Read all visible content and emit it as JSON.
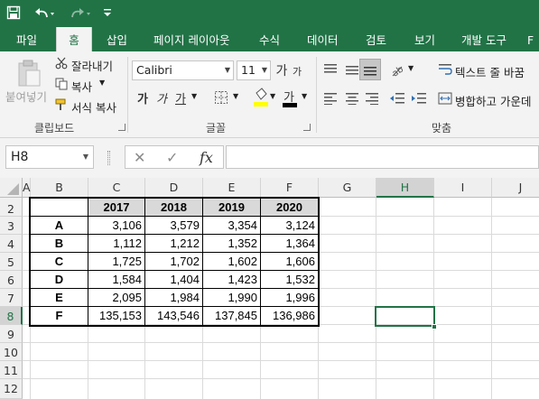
{
  "quick_access": {
    "save_icon": "save-icon",
    "undo_icon": "undo-icon",
    "redo_icon": "redo-icon",
    "customize_icon": "customize-icon"
  },
  "tabs": [
    "파일",
    "홈",
    "삽입",
    "페이지 레이아웃",
    "수식",
    "데이터",
    "검토",
    "보기",
    "개발 도구",
    "F"
  ],
  "active_tab": "홈",
  "ribbon": {
    "clipboard": {
      "paste": "붙여넣기",
      "cut": "잘라내기",
      "copy": "복사",
      "format_painter": "서식 복사",
      "label": "클립보드"
    },
    "font": {
      "name": "Calibri",
      "size": "11",
      "bold": "가",
      "italic": "가",
      "underline": "가",
      "label": "글꼴",
      "font_color_glyph": "가",
      "grow": "가",
      "shrink": "가"
    },
    "alignment": {
      "wrap_text": "텍스트 줄 바꿈",
      "merge_center": "병합하고 가운데",
      "label": "맞춤"
    }
  },
  "formula_bar": {
    "name_box": "H8",
    "cancel": "✕",
    "enter": "✓",
    "fx": "fx",
    "formula": ""
  },
  "columns": [
    "A",
    "B",
    "C",
    "D",
    "E",
    "F",
    "G",
    "H",
    "I",
    "J"
  ],
  "rows": [
    "2",
    "3",
    "4",
    "5",
    "6",
    "7",
    "8",
    "9",
    "10",
    "11",
    "12"
  ],
  "selected_cell": "H8",
  "table": {
    "headers": [
      "2017",
      "2018",
      "2019",
      "2020"
    ],
    "rows": [
      {
        "label": "A",
        "values": [
          "3,106",
          "3,579",
          "3,354",
          "3,124"
        ]
      },
      {
        "label": "B",
        "values": [
          "1,112",
          "1,212",
          "1,352",
          "1,364"
        ]
      },
      {
        "label": "C",
        "values": [
          "1,725",
          "1,702",
          "1,602",
          "1,606"
        ]
      },
      {
        "label": "D",
        "values": [
          "1,584",
          "1,404",
          "1,423",
          "1,532"
        ]
      },
      {
        "label": "E",
        "values": [
          "2,095",
          "1,984",
          "1,990",
          "1,996"
        ]
      },
      {
        "label": "F",
        "values": [
          "135,153",
          "143,546",
          "137,845",
          "136,986"
        ]
      }
    ]
  },
  "colors": {
    "brand": "#217346",
    "header_fill": "#d9d9d9"
  }
}
